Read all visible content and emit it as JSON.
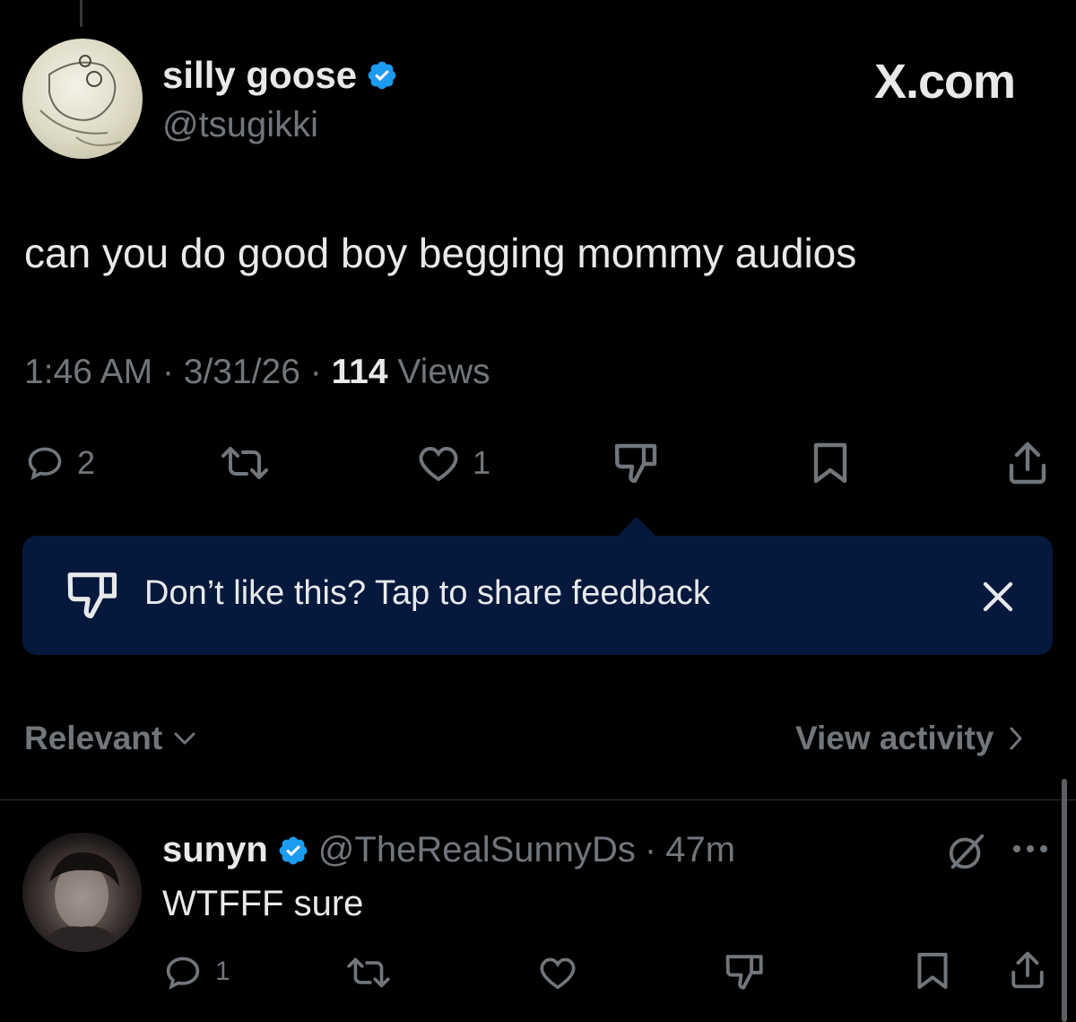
{
  "colors": {
    "background": "#000000",
    "primary_text": "#e7e9ea",
    "secondary_text": "#71767b",
    "verified_blue": "#1d9bf0",
    "tooltip_bg": "#06183c"
  },
  "post": {
    "display_name": "silly goose",
    "handle": "@tsugikki",
    "brand": "X.com",
    "text": "can you do good boy begging mommy audios",
    "time": "1:46 AM",
    "date": "3/31/26",
    "separator": "·",
    "views_count": "114",
    "views_label": "Views",
    "actions": {
      "replies": "2",
      "likes": "1"
    }
  },
  "tooltip": {
    "text": "Don’t like this? Tap to share feedback"
  },
  "replies_header": {
    "sort_label": "Relevant",
    "view_activity_label": "View activity"
  },
  "reply": {
    "display_name": "sunyn",
    "handle": "@TheRealSunnyDs",
    "separator": "·",
    "time": "47m",
    "text": "WTFFF sure",
    "actions": {
      "replies": "1"
    }
  },
  "icons": [
    "verified-badge-icon",
    "reply-icon",
    "repost-icon",
    "like-icon",
    "dislike-icon",
    "bookmark-icon",
    "share-icon",
    "close-icon",
    "chevron-down-icon",
    "chevron-right-icon",
    "grok-icon",
    "more-icon"
  ]
}
